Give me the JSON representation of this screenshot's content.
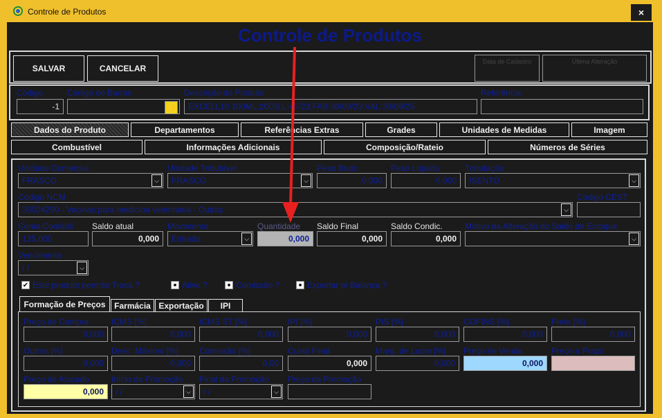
{
  "window": {
    "title": "Controle de Produtos",
    "close_glyph": "×",
    "icon": "app-globe-icon"
  },
  "header": {
    "title": "Controle de Produtos"
  },
  "toolbar": {
    "save_label": "SALVAR",
    "cancel_label": "CANCELAR",
    "data_cadastro_label": "Data de Cadastro",
    "ultima_alteracao_label": "Última Alteração"
  },
  "product": {
    "codigo_label": "Código",
    "codigo_value": "-1",
    "barras_label": "Código de Barras",
    "barras_value": "",
    "barras_icon_glyph": "⚡",
    "descricao_label": "Descrição do Produto",
    "descricao_value": "EXCELL10 100ML;20DS;L:45/23;FAB:30/09/23;VAL:30/09/25",
    "referencia_label": "Referência",
    "referencia_value": ""
  },
  "tabs_row1": [
    "Dados do Produto",
    "Departamentos",
    "Referências Extras",
    "Grades",
    "Unidades de Medidas",
    "Imagem"
  ],
  "tabs_row2": [
    "Combustível",
    "Informações Adicionais",
    "Composição/Rateio",
    "Números de Séries"
  ],
  "dados": {
    "unidade_comercial_label": "Unidade Comercial",
    "unidade_comercial_value": "FRASCO",
    "unidade_tributavel_label": "Unidade Tributável",
    "unidade_tributavel_value": "FRASCO",
    "peso_bruto_label": "Peso Bruto",
    "peso_bruto_value": "0,000",
    "peso_liquido_label": "Peso Líquido",
    "peso_liquido_value": "0,000",
    "tributacao_label": "Tributação",
    "tributacao_value": "ISENTO",
    "ncm_label": "Código NCM",
    "ncm_value": "30024290 - Vacinas para medicina veterinária - Outras",
    "cest_label": "Código CEST",
    "cest_value": "",
    "conta_contabil_label": "Conta Contábil",
    "conta_contabil_value": "125.000",
    "saldo_atual_label": "Saldo atual",
    "saldo_atual_value": "0,000",
    "movimento_label": "Movimento",
    "movimento_value": "Entrada",
    "quantidade_label": "Quantidade",
    "quantidade_value": "0,000",
    "saldo_final_label": "Saldo Final",
    "saldo_final_value": "0,000",
    "saldo_condic_label": "Saldo Condic.",
    "saldo_condic_value": "0,000",
    "motivo_label": "Motivo da Alteração do Saldo de Estoque",
    "motivo_value": "",
    "vencimento_label": "Vencimento",
    "vencimento_value": "  /  /",
    "chk_troca_label": "Este produto permite Troca ?",
    "chk_troca_glyph": "✔",
    "chk_ativo_label": "Ativo ?",
    "chk_ativo_glyph": "■",
    "chk_comissao_label": "Comissão ?",
    "chk_comissao_glyph": "■",
    "chk_balanca_label": "Exportar p/ Balança ?",
    "chk_balanca_glyph": "■"
  },
  "subtabs": [
    "Formação de Preços",
    "Farmácia",
    "Exportação",
    "IPI"
  ],
  "precos": {
    "preco_compra_label": "Preço de Compra",
    "preco_compra_value": "0,000",
    "icms_label": "ICMS [%]",
    "icms_value": "0,000",
    "icms_st_label": "ICMS ST [%]",
    "icms_st_value": "0,000",
    "ipi_label": "IPI [%]",
    "ipi_value": "0,000",
    "pis_label": "PIS [%]",
    "pis_value": "0,000",
    "cofins_label": "COFINS [%]",
    "cofins_value": "0,000",
    "frete_label": "Frete [%]",
    "frete_value": "0,000",
    "outros_label": "Outros [%]",
    "outros_value": "0,000",
    "desc_max_label": "Desc. Máximo [%]",
    "desc_max_value": "0,000",
    "comissao_label": "Comissão [%]",
    "comissao_value": "0,00",
    "custo_final_label": "Custo Final",
    "custo_final_value": "0,000",
    "marg_lucro_label": "Marg. de Lucro [%]",
    "marg_lucro_value": "0,000",
    "preco_venda_label": "Preço de Venda",
    "preco_venda_value": "0,000",
    "preco_prazo_label": "Preço a Prazo",
    "preco_prazo_value": "",
    "preco_atacado_label": "Preço de Atacado",
    "preco_atacado_value": "0,000",
    "inicio_promo_label": "Início da Promoção",
    "inicio_promo_value": "  /  /",
    "final_promo_label": "Final da Promoção",
    "final_promo_value": "  /  /",
    "preco_promo_label": "Preço da Promoção",
    "preco_promo_value": ""
  },
  "dropdown_glyph": "⌵",
  "colors": {
    "accent_yellow": "#f0c02c",
    "label_blue": "#0d1f9c",
    "arrow_red": "#e82020",
    "venda_bg": "#9fd8ff",
    "atacado_bg": "#ffffa6",
    "prazo_bg": "#dcbcbc"
  }
}
